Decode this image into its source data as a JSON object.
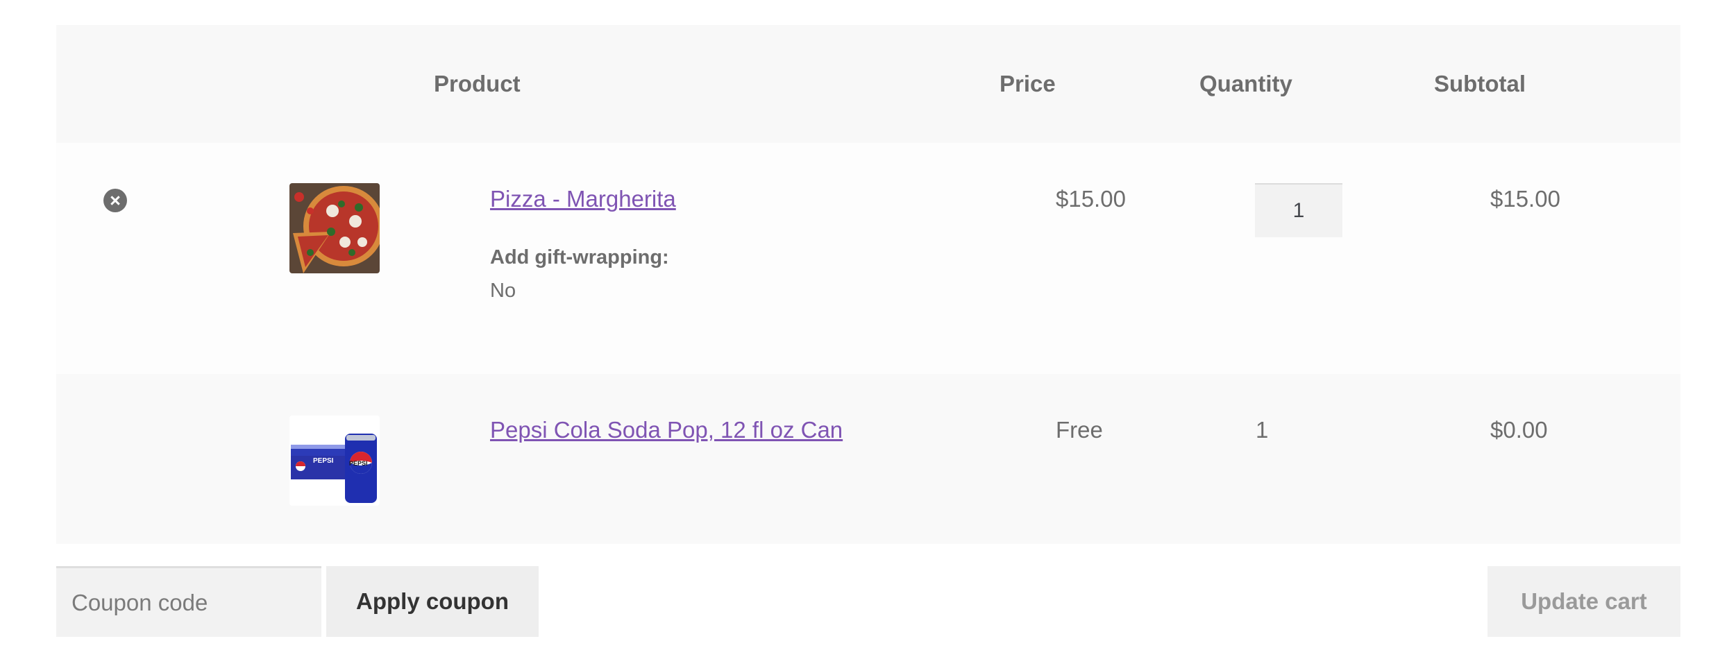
{
  "table": {
    "headers": {
      "product": "Product",
      "price": "Price",
      "quantity": "Quantity",
      "subtotal": "Subtotal"
    },
    "items": [
      {
        "remove_icon": "close-circle-icon",
        "thumbnail": "pizza-image",
        "name": "Pizza - Margherita",
        "meta_label": "Add gift-wrapping:",
        "meta_value": "No",
        "price": "$15.00",
        "quantity": "1",
        "subtotal": "$15.00"
      },
      {
        "thumbnail": "pepsi-can-image",
        "name": "Pepsi Cola Soda Pop, 12 fl oz Can",
        "price": "Free",
        "quantity": "1",
        "subtotal": "$0.00"
      }
    ]
  },
  "actions": {
    "coupon_placeholder": "Coupon code",
    "apply_label": "Apply coupon",
    "update_label": "Update cart"
  },
  "colors": {
    "link": "#7f54b3",
    "text": "#6d6d6d",
    "header_bg": "#f8f8f8"
  }
}
